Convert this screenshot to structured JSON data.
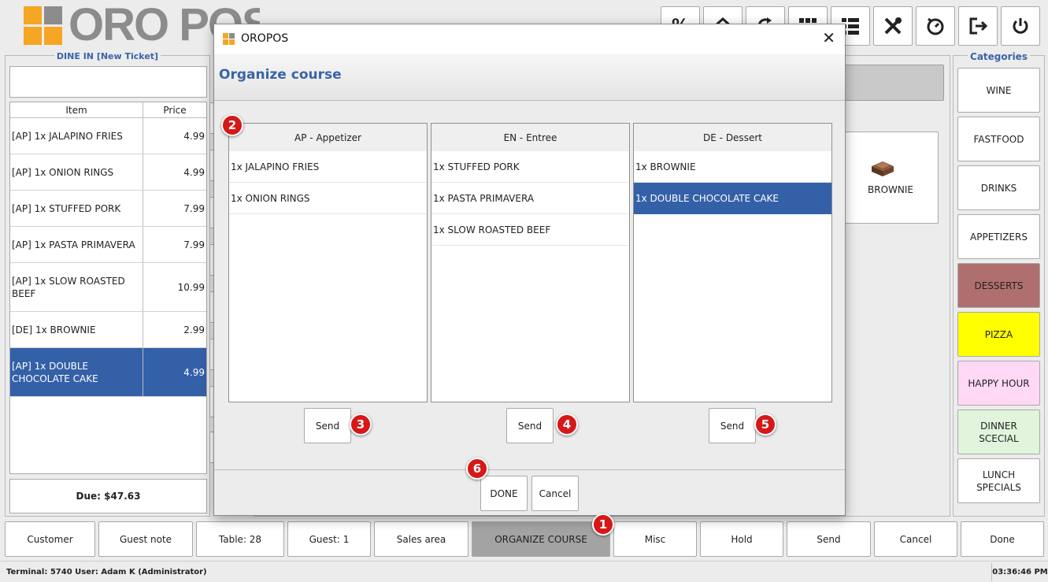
{
  "app": {
    "logo_text": "ORO POS",
    "logo_colors": [
      "#f5a623",
      "#8c8c8c"
    ]
  },
  "toolbar": {
    "icons": [
      "percent-icon",
      "home-icon",
      "refresh-icon",
      "grid-icon",
      "list-icon",
      "tools-icon",
      "timer-icon",
      "logout-icon",
      "power-icon"
    ]
  },
  "ticket": {
    "title": "DINE IN [New Ticket]",
    "col_item": "Item",
    "col_price": "Price",
    "rows": [
      {
        "item": "[AP]  1x JALAPINO FRIES",
        "price": "4.99"
      },
      {
        "item": "[AP]  1x ONION RINGS",
        "price": "4.99"
      },
      {
        "item": "[AP]  1x STUFFED PORK",
        "price": "7.99"
      },
      {
        "item": "[AP]  1x PASTA PRIMAVERA",
        "price": "7.99"
      },
      {
        "item": "[AP]  1x SLOW ROASTED BEEF",
        "price": "10.99"
      },
      {
        "item": "[DE]  1x BROWNIE",
        "price": "2.99"
      },
      {
        "item": "[AP]  1x DOUBLE CHOCOLATE CAKE",
        "price": "4.99"
      }
    ],
    "due": "Due: $47.63"
  },
  "menu_item": {
    "label": "BROWNIE"
  },
  "categories": {
    "title": "Categories",
    "items": [
      {
        "label": "WINE",
        "color": "#ffffff"
      },
      {
        "label": "FASTFOOD",
        "color": "#ffffff"
      },
      {
        "label": "DRINKS",
        "color": "#ffffff"
      },
      {
        "label": "APPETIZERS",
        "color": "#ffffff"
      },
      {
        "label": "DESSERTS",
        "color": "#b06f6f"
      },
      {
        "label": "PIZZA",
        "color": "#ffff00"
      },
      {
        "label": "HAPPY HOUR",
        "color": "#ffd8f5"
      },
      {
        "label": "DINNER SCECIAL",
        "color": "#e0f5dc"
      },
      {
        "label": "LUNCH SPECIALS",
        "color": "#ffffff"
      }
    ]
  },
  "bottom_bar": {
    "customer": "Customer",
    "guest_note": "Guest note",
    "table": "Table: 28",
    "guest": "Guest: 1",
    "sales_area": "Sales area",
    "organize_course": "ORGANIZE COURSE",
    "misc": "Misc",
    "hold": "Hold",
    "send": "Send",
    "cancel": "Cancel",
    "done": "Done"
  },
  "status_bar": {
    "left": "Terminal: 5740 User: Adam K (Administrator)",
    "time": "03:36:46 PM"
  },
  "dialog": {
    "window_title": "OROPOS",
    "heading": "Organize course",
    "courses": [
      {
        "name": "AP - Appetizer",
        "items": [
          "1x JALAPINO FRIES",
          "1x ONION RINGS"
        ]
      },
      {
        "name": "EN - Entree",
        "items": [
          "1x STUFFED PORK",
          "1x PASTA PRIMAVERA",
          "1x SLOW ROASTED BEEF"
        ]
      },
      {
        "name": "DE - Dessert",
        "items": [
          "1x BROWNIE",
          "1x DOUBLE CHOCOLATE CAKE"
        ]
      }
    ],
    "send_label": "Send",
    "done_label": "DONE",
    "cancel_label": "Cancel"
  },
  "annotations": [
    "1",
    "2",
    "3",
    "4",
    "5",
    "6"
  ],
  "colors": {
    "accent": "#3a63a8",
    "selection": "#3460a8",
    "badge": "#d61818"
  }
}
